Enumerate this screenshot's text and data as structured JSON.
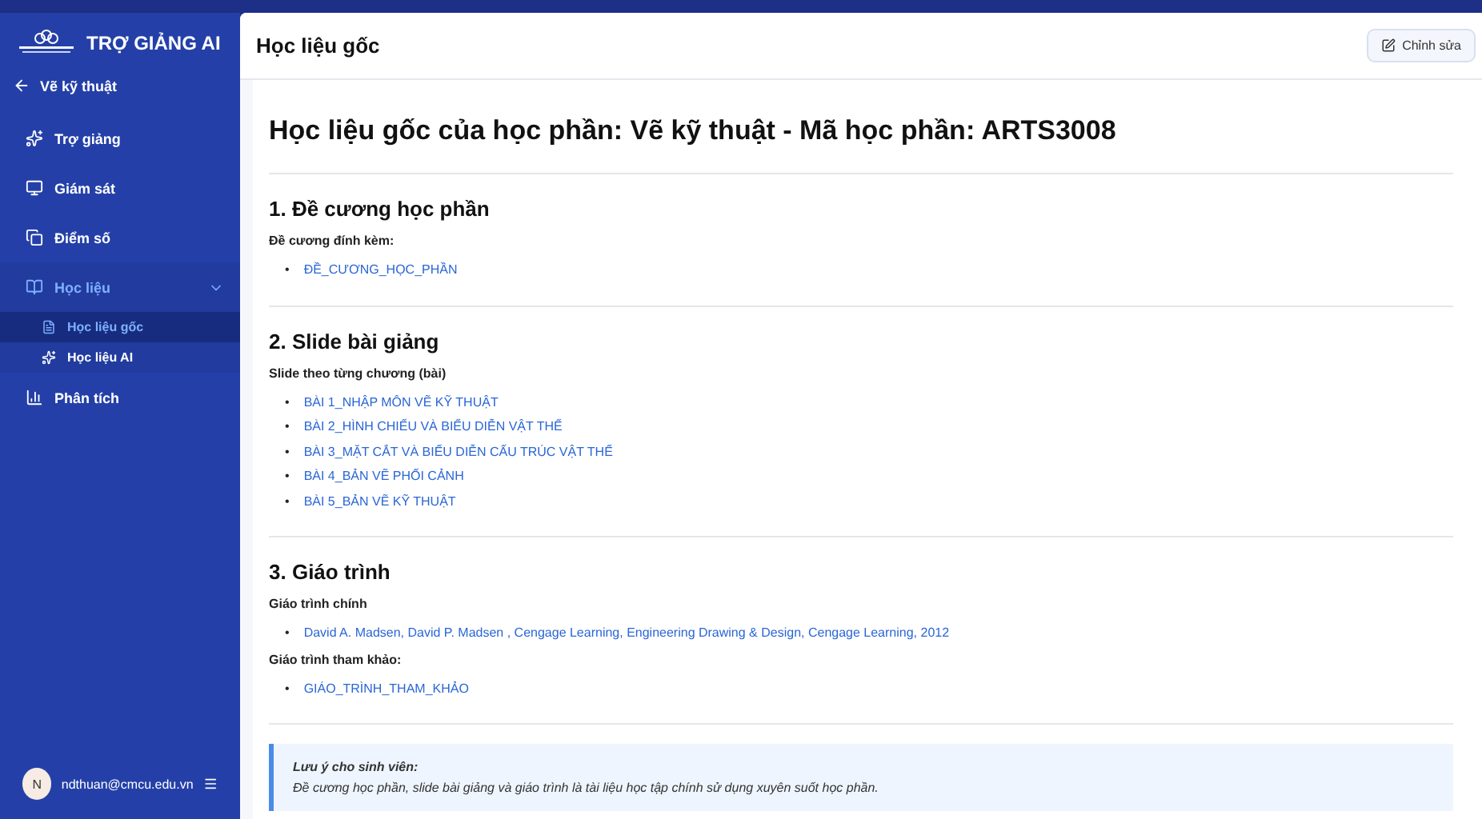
{
  "sidebar": {
    "brand": "TRỢ GIẢNG AI",
    "back": "Vẽ kỹ thuật",
    "items": [
      {
        "label": "Trợ giảng",
        "selected": false
      },
      {
        "label": "Giám sát",
        "selected": false
      },
      {
        "label": "Điểm số",
        "selected": false
      },
      {
        "label": "Học liệu",
        "selected": false,
        "expanded": true,
        "children": [
          {
            "label": "Học liệu gốc",
            "selected": true
          },
          {
            "label": "Học liệu AI",
            "selected": false
          }
        ]
      },
      {
        "label": "Phân tích",
        "selected": false
      }
    ],
    "user": {
      "initial": "N",
      "email": "ndthuan@cmcu.edu.vn"
    }
  },
  "header": {
    "title": "Học liệu gốc",
    "button": "Chỉnh sửa"
  },
  "content": {
    "title": "Học liệu gốc của học phần: Vẽ kỹ thuật - Mã học phần: ARTS3008",
    "sections": [
      {
        "heading": "1. Đề cương học phần",
        "groups": [
          {
            "label": "Đề cương đính kèm:",
            "marker": "•",
            "links": [
              "ĐỀ_CƯƠNG_HỌC_PHẦN"
            ]
          }
        ]
      },
      {
        "heading": "2. Slide bài giảng",
        "groups": [
          {
            "label": "Slide theo từng chương (bài)",
            "marker": "•",
            "links": [
              "BÀI 1_NHẬP MÔN VẼ KỸ THUẬT",
              "BÀI 2_HÌNH CHIẾU VÀ BIỂU DIỄN VẬT THỂ",
              "BÀI 3_MẶT CẮT VÀ BIỂU DIỄN CẤU TRÚC VẬT THỂ",
              "BÀI 4_BẢN VẼ PHỐI CẢNH",
              "BÀI 5_BẢN VẼ KỸ THUẬT"
            ]
          }
        ]
      },
      {
        "heading": "3. Giáo trình",
        "groups": [
          {
            "label": "Giáo trình chính",
            "marker": "•",
            "links": [
              "David A. Madsen, David P. Madsen , Cengage Learning, Engineering Drawing & Design, Cengage Learning, 2012"
            ]
          },
          {
            "label": "Giáo trình tham khảo:",
            "marker": "•",
            "links": [
              "GIÁO_TRÌNH_THAM_KHẢO"
            ]
          }
        ]
      }
    ],
    "note": {
      "title": "Lưu ý cho sinh viên:",
      "text": "Đề cương học phần, slide bài giảng và giáo trình là tài liệu học tập chính sử dụng xuyên suốt học phần."
    }
  }
}
